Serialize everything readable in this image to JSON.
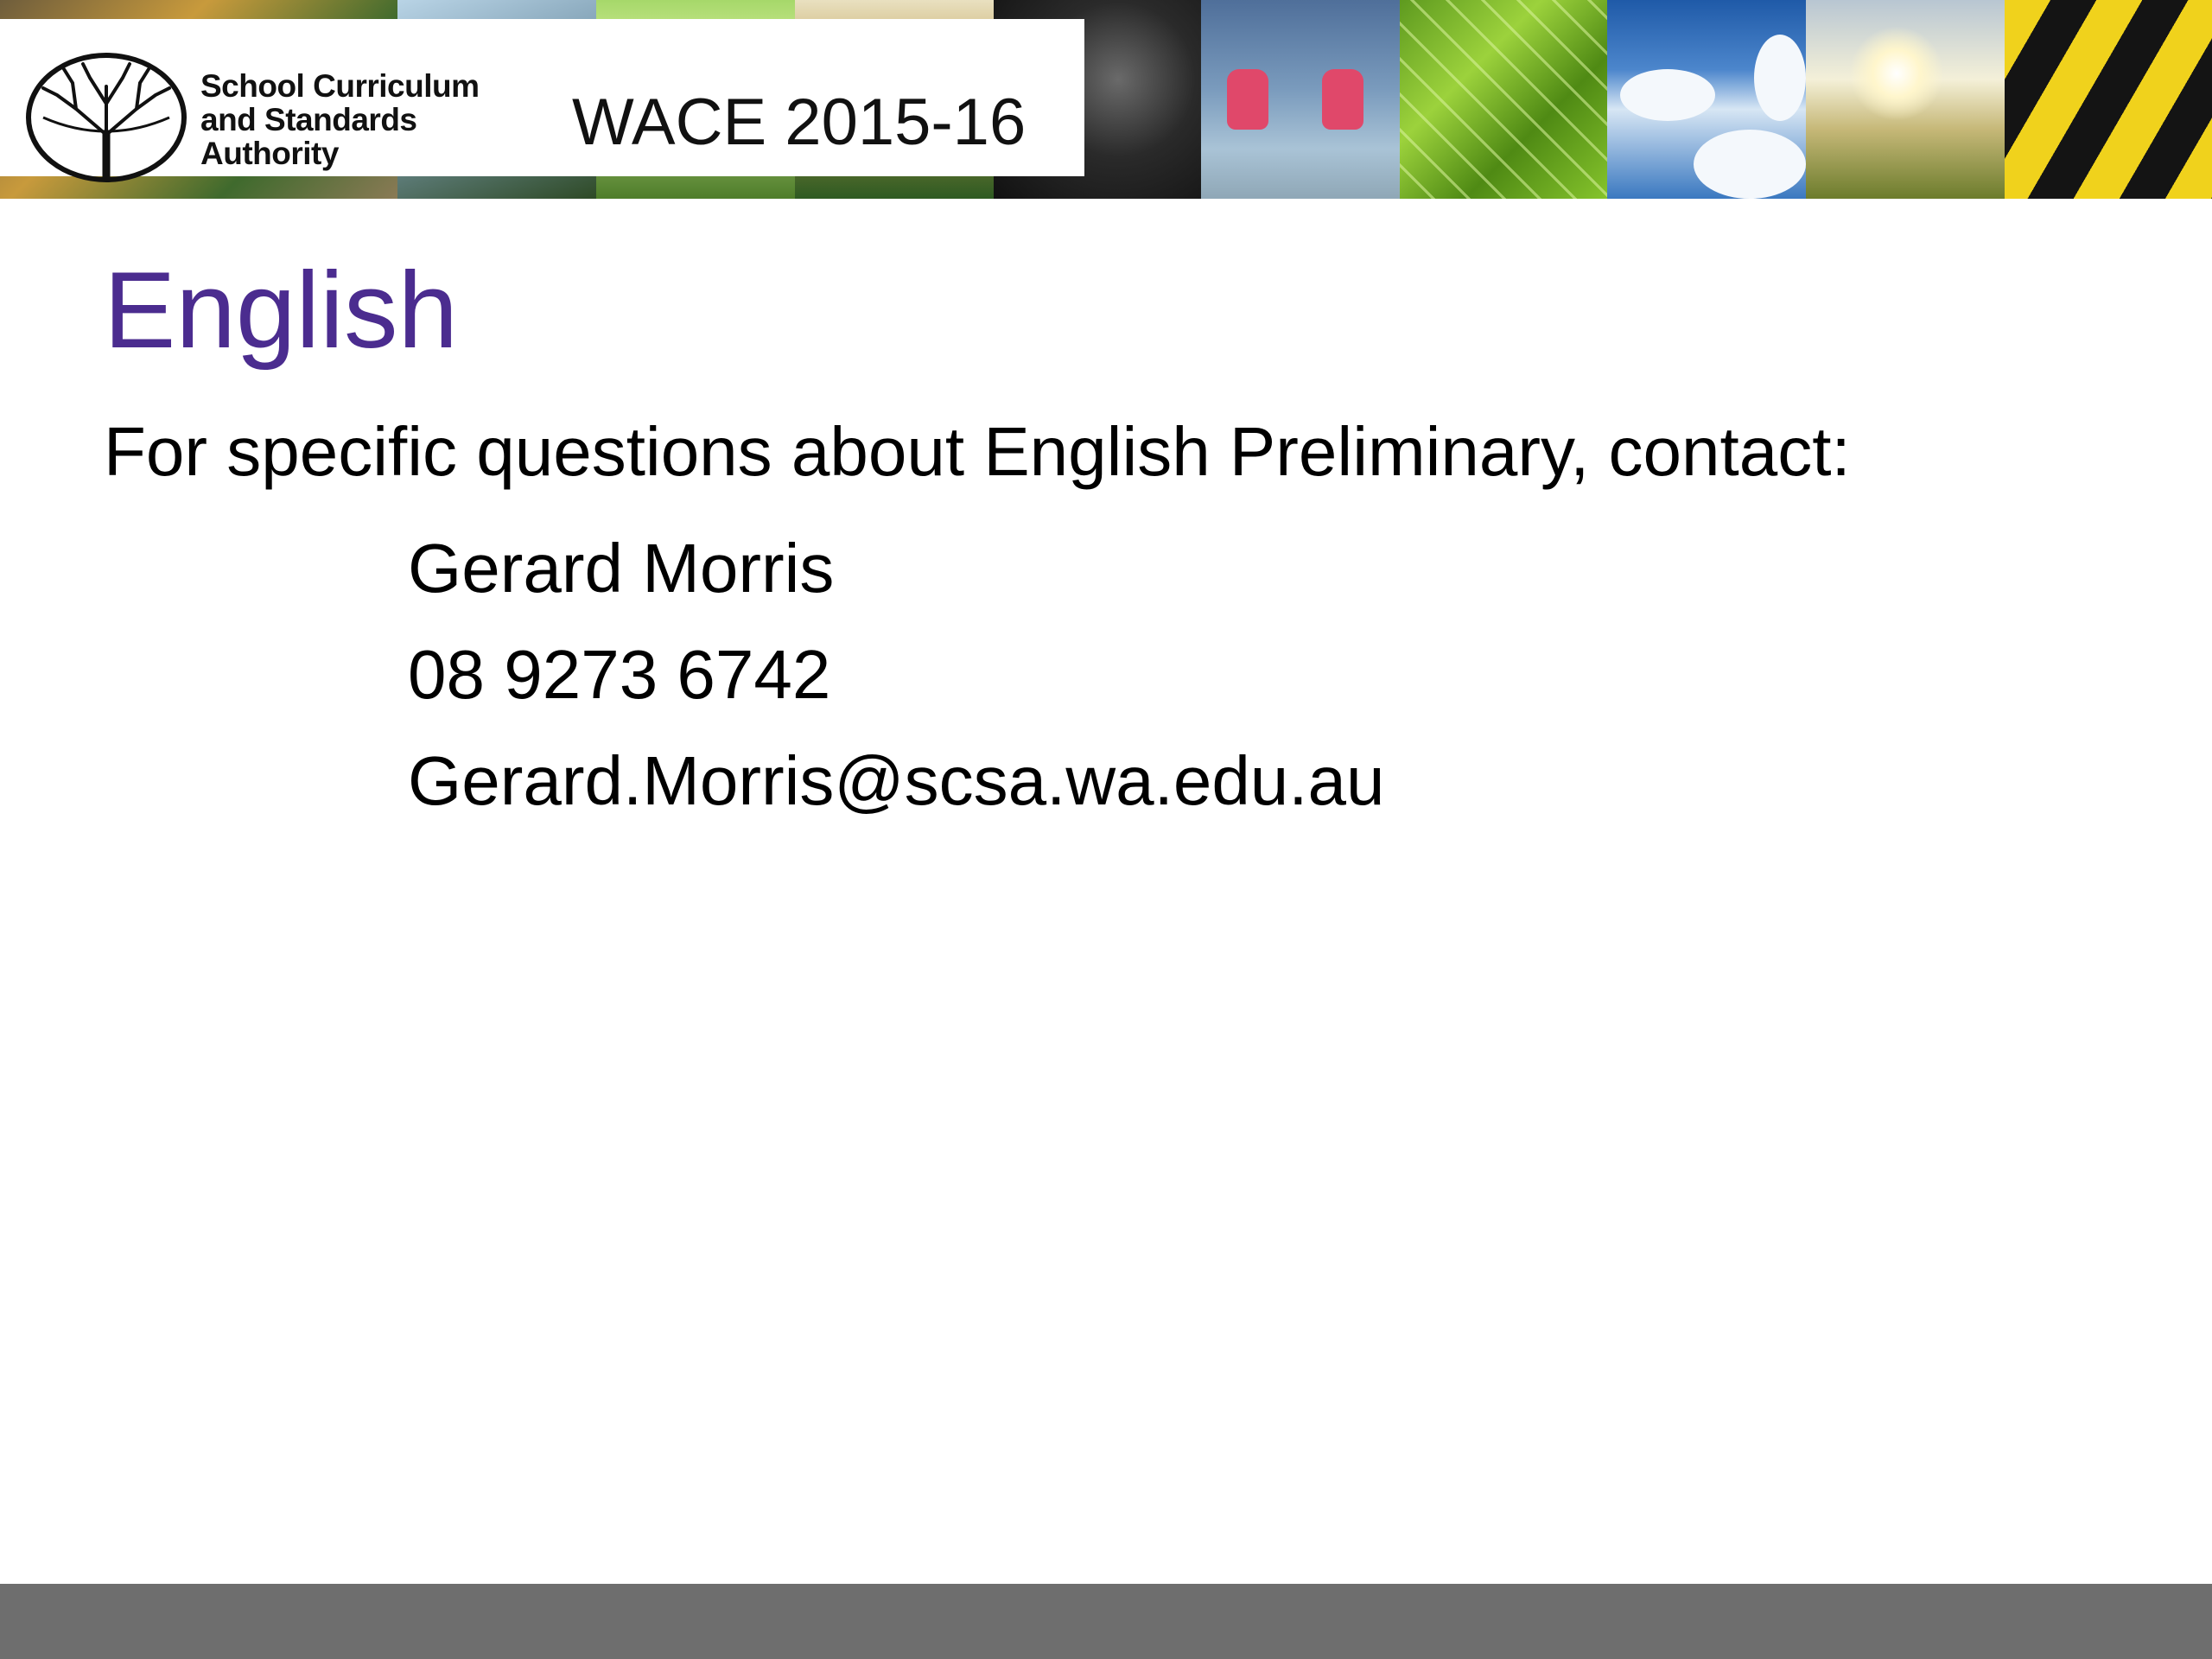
{
  "header": {
    "authority_name": [
      "School Curriculum",
      "and Standards",
      "Authority"
    ],
    "banner_title": "WACE 2015-16",
    "logo_icon": "tree-logo"
  },
  "slide": {
    "title": "English",
    "intro": "For specific questions about English Preliminary, contact:",
    "contact": {
      "name": "Gerard Morris",
      "phone": "08 9273 6742",
      "email": "Gerard.Morris@scsa.wa.edu.au"
    }
  },
  "colors": {
    "title": "#4b2c8f",
    "body_text": "#000000",
    "footer_bar": "#6e6e6e"
  }
}
